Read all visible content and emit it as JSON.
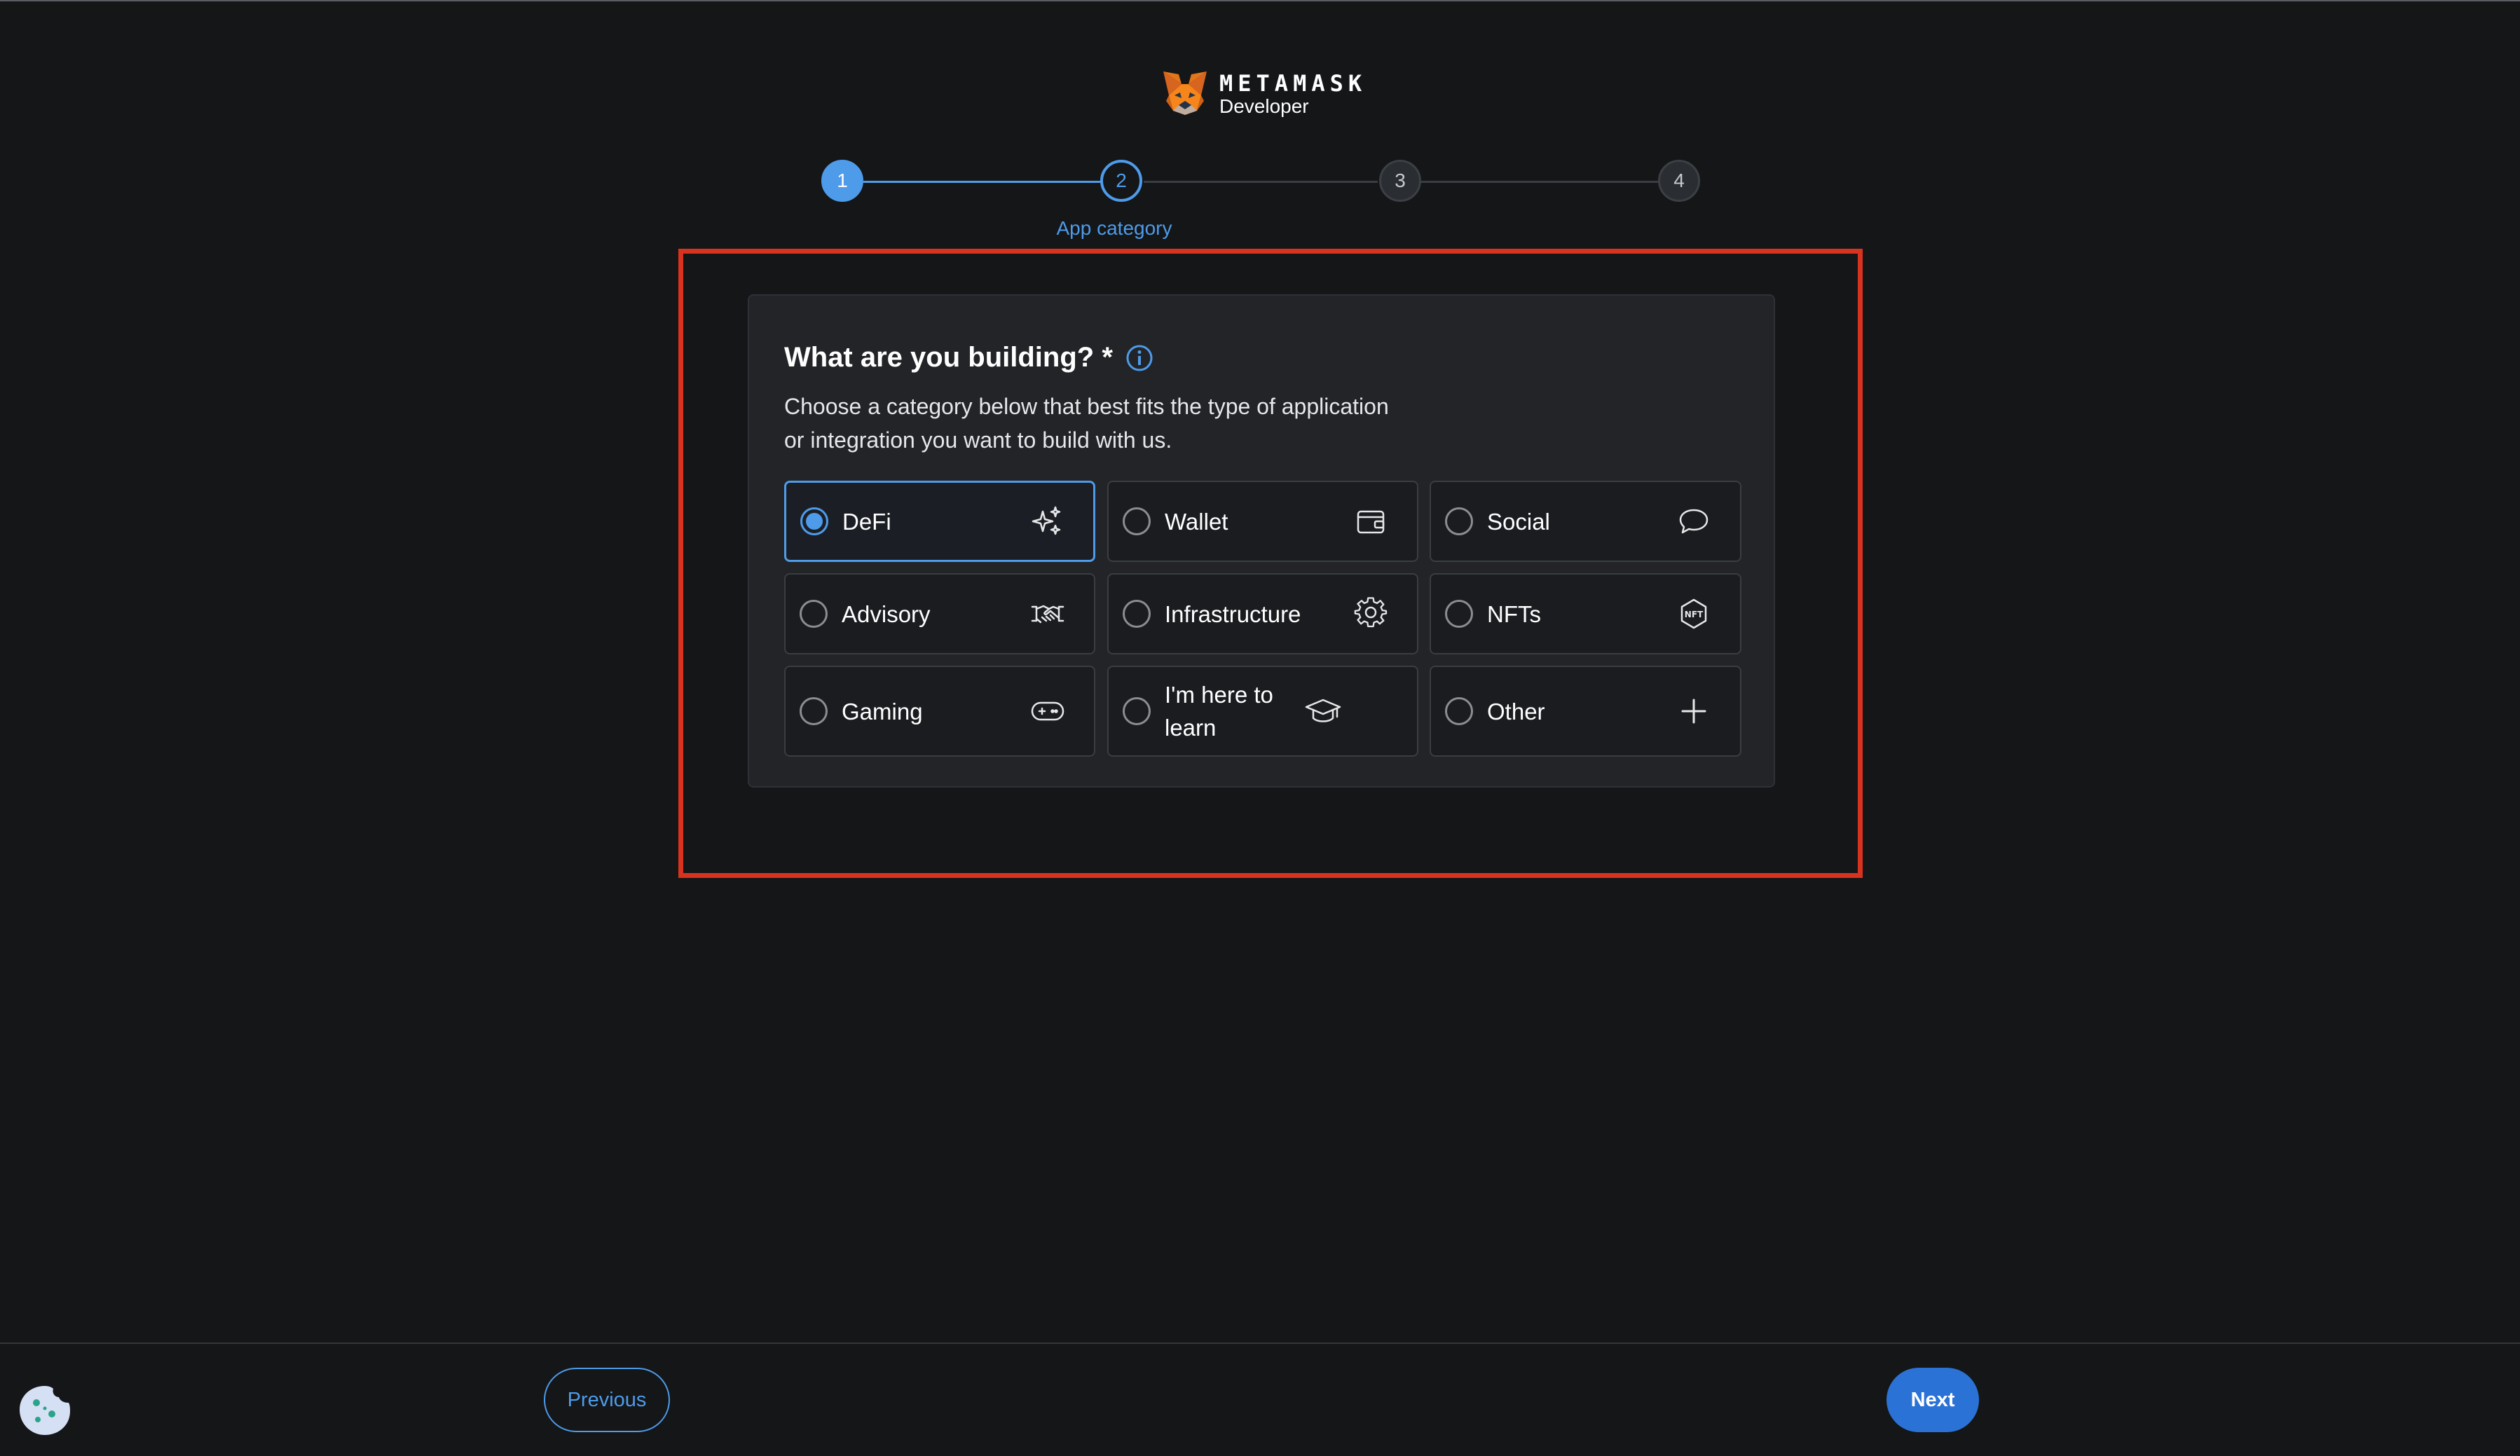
{
  "brand": {
    "name": "METAMASK",
    "subtitle": "Developer"
  },
  "stepper": {
    "steps": [
      "1",
      "2",
      "3",
      "4"
    ],
    "current_step": 2,
    "current_label": "App category"
  },
  "question": {
    "title": "What are you building? *",
    "description": "Choose a category below that best fits the type of application or integration you want to build with us."
  },
  "options": [
    {
      "label": "DeFi",
      "icon": "sparkles-icon",
      "selected": true
    },
    {
      "label": "Wallet",
      "icon": "wallet-icon",
      "selected": false
    },
    {
      "label": "Social",
      "icon": "chat-bubble-icon",
      "selected": false
    },
    {
      "label": "Advisory",
      "icon": "handshake-icon",
      "selected": false
    },
    {
      "label": "Infrastructure",
      "icon": "gear-icon",
      "selected": false
    },
    {
      "label": "NFTs",
      "icon": "nft-badge-icon",
      "selected": false
    },
    {
      "label": "Gaming",
      "icon": "gamepad-icon",
      "selected": false
    },
    {
      "label": "I'm here to learn",
      "icon": "graduation-cap-icon",
      "selected": false
    },
    {
      "label": "Other",
      "icon": "plus-icon",
      "selected": false
    }
  ],
  "footer": {
    "previous_label": "Previous",
    "next_label": "Next"
  },
  "colors": {
    "accent": "#4e9bea",
    "background": "#141618",
    "card": "#222427",
    "highlight": "#d9321f",
    "next_button": "#2b72d6"
  }
}
